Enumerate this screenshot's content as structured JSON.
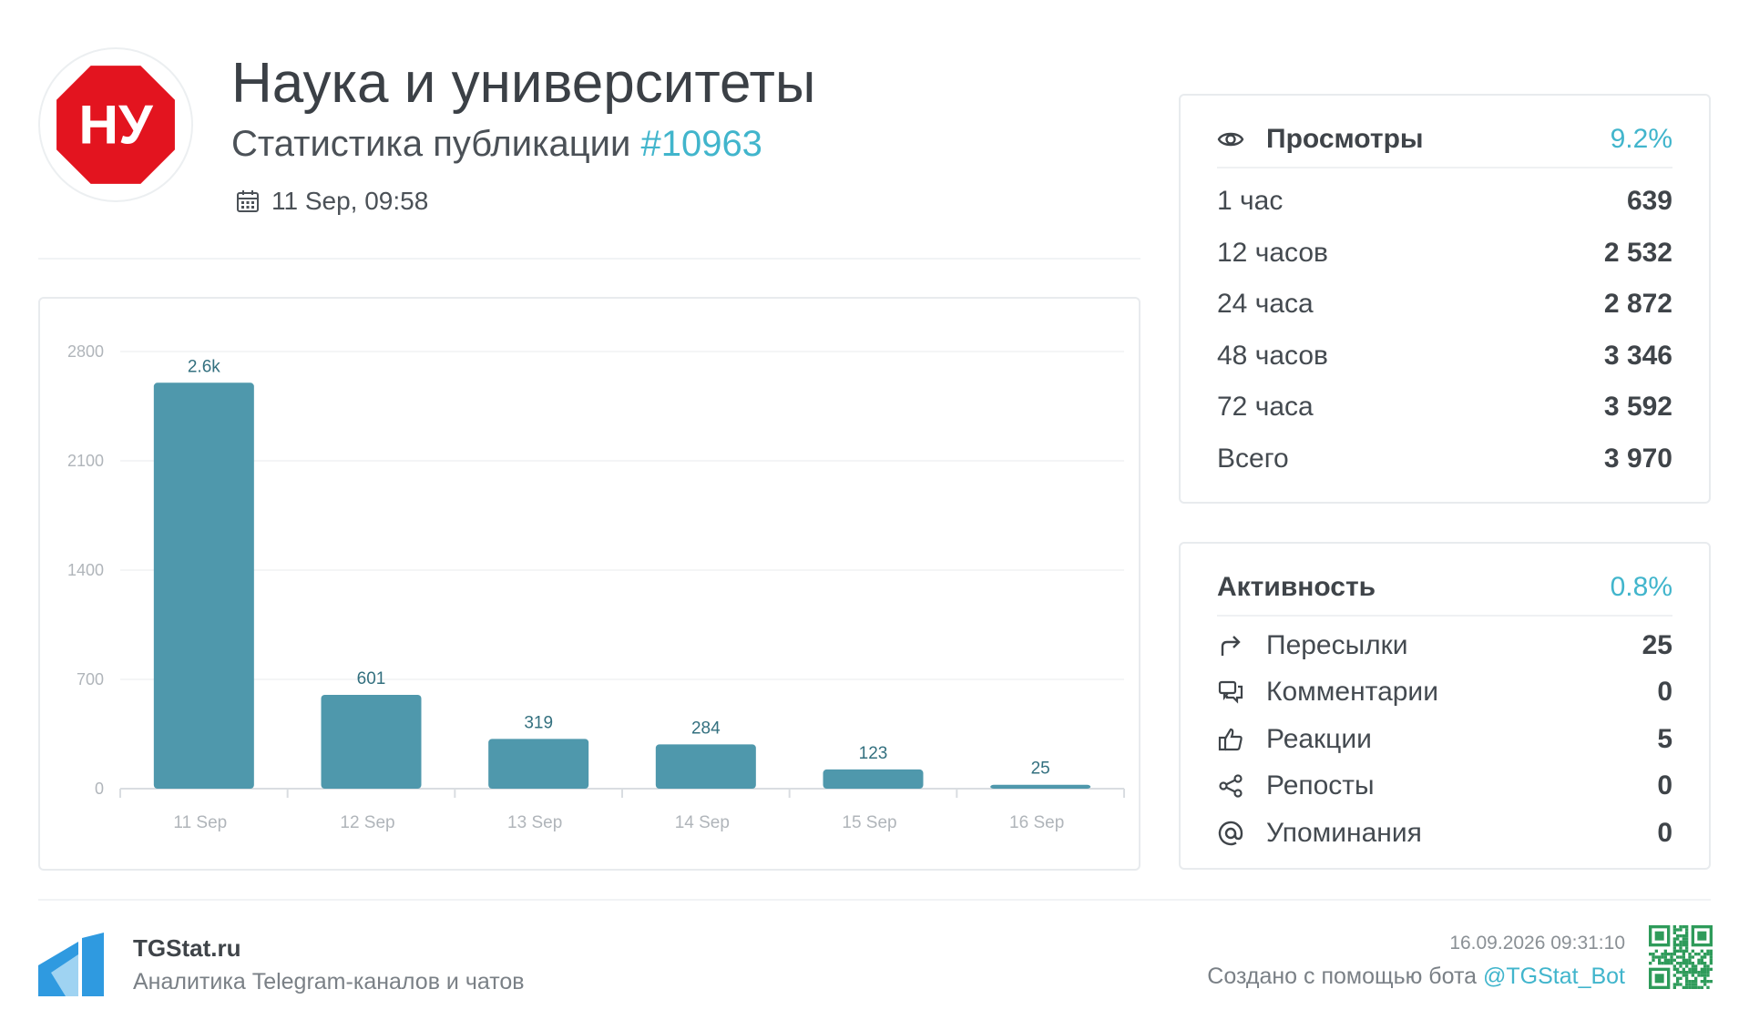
{
  "header": {
    "logo_text": "НУ",
    "title": "Наука и университеты",
    "subtitle_prefix": "Статистика публикации",
    "publication_id": "#10963",
    "date": "11 Sep, 09:58"
  },
  "chart_data": {
    "type": "bar",
    "categories": [
      "11 Sep",
      "12 Sep",
      "13 Sep",
      "14 Sep",
      "15 Sep",
      "16 Sep"
    ],
    "values": [
      2600,
      601,
      319,
      284,
      123,
      25
    ],
    "value_labels": [
      "2.6k",
      "601",
      "319",
      "284",
      "123",
      "25"
    ],
    "yticks": [
      "0",
      "700",
      "1400",
      "2100",
      "2800"
    ],
    "ylim": [
      0,
      2800
    ],
    "grid": true,
    "bar_color": "#4f98ac"
  },
  "views": {
    "title": "Просмотры",
    "percent": "9.2%",
    "rows": [
      {
        "label": "1 час",
        "value": "639"
      },
      {
        "label": "12 часов",
        "value": "2 532"
      },
      {
        "label": "24 часа",
        "value": "2 872"
      },
      {
        "label": "48 часов",
        "value": "3 346"
      },
      {
        "label": "72 часа",
        "value": "3 592"
      },
      {
        "label": "Всего",
        "value": "3 970"
      }
    ]
  },
  "activity": {
    "title": "Активность",
    "percent": "0.8%",
    "rows": [
      {
        "icon": "forward-icon",
        "label": "Пересылки",
        "value": "25"
      },
      {
        "icon": "comments-icon",
        "label": "Комментарии",
        "value": "0"
      },
      {
        "icon": "thumbs-up-icon",
        "label": "Реакции",
        "value": "5"
      },
      {
        "icon": "share-icon",
        "label": "Репосты",
        "value": "0"
      },
      {
        "icon": "at-icon",
        "label": "Упоминания",
        "value": "0"
      }
    ]
  },
  "footer": {
    "brand": "TGStat.ru",
    "description": "Аналитика Telegram-каналов и чатов",
    "timestamp": "16.09.2026 09:31:10",
    "credit_prefix": "Создано с помощью бота",
    "bot": "@TGStat_Bot"
  },
  "colors": {
    "accent": "#41b5cc",
    "bar": "#4f98ac",
    "logo_red": "#e3141f"
  }
}
